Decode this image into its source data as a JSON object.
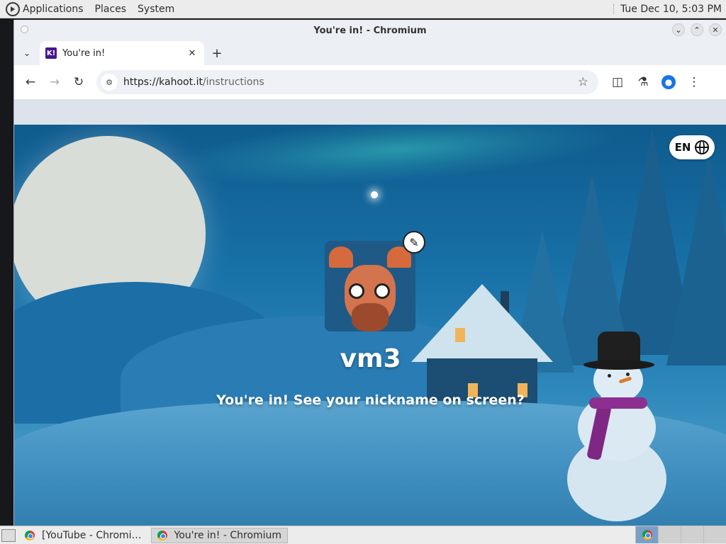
{
  "top_panel": {
    "menus": [
      "Applications",
      "Places",
      "System"
    ],
    "clock": "Tue Dec 10,  5:03 PM"
  },
  "window": {
    "title": "You're in! - Chromium",
    "controls": [
      "minimize-icon",
      "maximize-icon",
      "close-icon"
    ]
  },
  "tabs": [
    {
      "label": "You're in!",
      "favicon": "K!",
      "active": true
    }
  ],
  "toolbar": {
    "url_host": "https://kahoot.it",
    "url_path": "/instructions"
  },
  "page": {
    "language": "EN",
    "nickname": "vm3",
    "status_message": "You're in! See your nickname on screen?"
  },
  "taskbar": {
    "tasks": [
      {
        "label": "[YouTube - Chromi…",
        "active": false
      },
      {
        "label": "You're in! - Chromium",
        "active": true
      }
    ]
  },
  "colors": {
    "kahoot_purple": "#46178f",
    "sky_blue": "#1770a6",
    "chrome_accent": "#1a73e8"
  }
}
